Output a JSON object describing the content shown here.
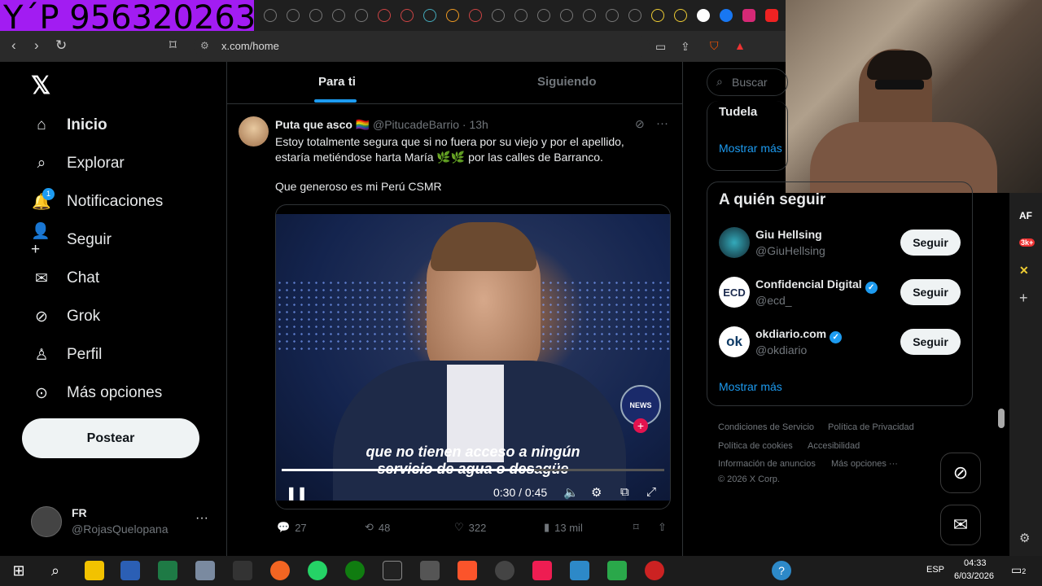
{
  "overlay": {
    "caption": "Y´P 956320263"
  },
  "browser": {
    "url": "x.com/home",
    "nav": {
      "back": "‹",
      "forward": "›",
      "reload": "↻"
    }
  },
  "sidebar": {
    "items": [
      {
        "label": "Inicio",
        "icon": "home-icon",
        "active": true
      },
      {
        "label": "Explorar",
        "icon": "search-icon"
      },
      {
        "label": "Notificaciones",
        "icon": "bell-icon",
        "badge": "1"
      },
      {
        "label": "Seguir",
        "icon": "add-person-icon"
      },
      {
        "label": "Chat",
        "icon": "mail-icon"
      },
      {
        "label": "Grok",
        "icon": "grok-icon"
      },
      {
        "label": "Perfil",
        "icon": "person-icon"
      },
      {
        "label": "Más opciones",
        "icon": "more-circle-icon"
      }
    ],
    "post_button": "Postear",
    "account": {
      "name": "FR",
      "handle": "@RojasQuelopana",
      "more": "···"
    }
  },
  "feed": {
    "tabs": [
      {
        "label": "Para ti",
        "active": true
      },
      {
        "label": "Siguiendo"
      }
    ],
    "post": {
      "author": "Puta que asco 🏳️‍🌈",
      "handle_time": "@PitucadeBarrio · 13h",
      "text_line1": "Estoy totalmente segura que si no fuera por su viejo y por el apellido,",
      "text_line2": "estaría metiéndose harta María 🌿🌿 por las calles de Barranco.",
      "text_line3": "Que generoso es mi Perú CSMR",
      "video": {
        "subtitle1": "que no tienen acceso a ningún",
        "subtitle2": "servicio de agua o desagüe",
        "timecode": "0:30 / 0:45",
        "progress": 0.66,
        "badge": "NEWS"
      },
      "actions": {
        "replies": "27",
        "reposts": "48",
        "likes": "322",
        "views": "13 mil"
      }
    }
  },
  "right": {
    "search_placeholder": "Buscar",
    "trend": {
      "name": "Tudela",
      "more": "Mostrar más"
    },
    "who_to_follow": {
      "title": "A quién seguir",
      "accounts": [
        {
          "name": "Giu Hellsing",
          "handle": "@GiuHellsing",
          "verified": false,
          "button": "Seguir"
        },
        {
          "name": "Confidencial Digital",
          "handle": "@ecd_",
          "verified": true,
          "button": "Seguir",
          "logo": "ECD"
        },
        {
          "name": "okdiario.com",
          "handle": "@okdiario",
          "verified": true,
          "button": "Seguir",
          "logo": "ok"
        }
      ],
      "more": "Mostrar más"
    },
    "footer": {
      "links": [
        "Condiciones de Servicio",
        "Política de Privacidad",
        "Política de cookies",
        "Accesibilidad",
        "Información de anuncios",
        "Más opciones ···"
      ],
      "copyright": "© 2026 X Corp."
    }
  },
  "sidepanel": {
    "items": [
      "AF",
      "3k+",
      "✕",
      "+"
    ]
  },
  "taskbar": {
    "lang": "ESP",
    "time": "04:33",
    "date": "6/03/2026",
    "notif": "2"
  }
}
